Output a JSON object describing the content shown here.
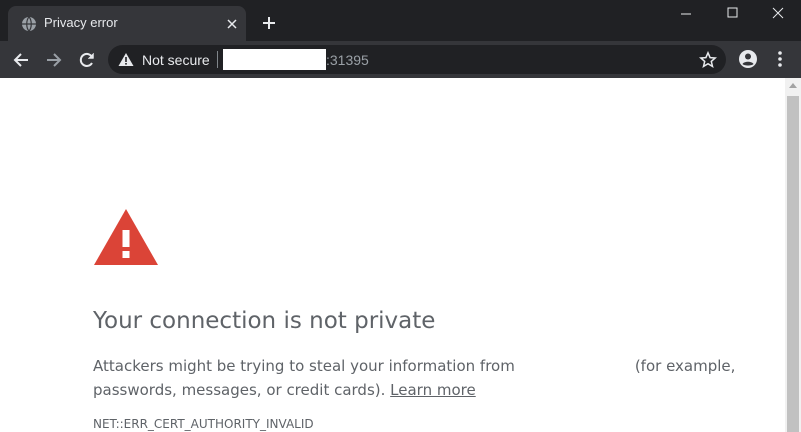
{
  "browser": {
    "tab": {
      "title": "Privacy error",
      "favicon": "globe-icon",
      "close_icon": "close-icon"
    },
    "new_tab_icon": "plus-icon",
    "window_controls": [
      "minimize-icon",
      "maximize-icon",
      "close-icon"
    ]
  },
  "toolbar": {
    "back_icon": "arrow-left-icon",
    "forward_icon": "arrow-right-icon",
    "reload_icon": "reload-icon",
    "omnibox": {
      "security_icon": "warning-icon",
      "security_label": "Not secure",
      "url_port": ":31395",
      "bookmark_icon": "star-icon"
    },
    "profile_icon": "account-circle-icon",
    "menu_icon": "more-vert-icon"
  },
  "page": {
    "icon": "warning-triangle-icon",
    "heading": "Your connection is not private",
    "body_part1": "Attackers might be trying to steal your information from",
    "body_part2": "(for example,",
    "body_part3": "passwords, messages, or credit cards).",
    "learn_more": "Learn more",
    "error_code": "NET::ERR_CERT_AUTHORITY_INVALID"
  },
  "colors": {
    "frame": "#202124",
    "toolbar": "#35363a",
    "text_light": "#e8eaed",
    "body_text": "#5f6368",
    "error_red": "#db4437"
  }
}
